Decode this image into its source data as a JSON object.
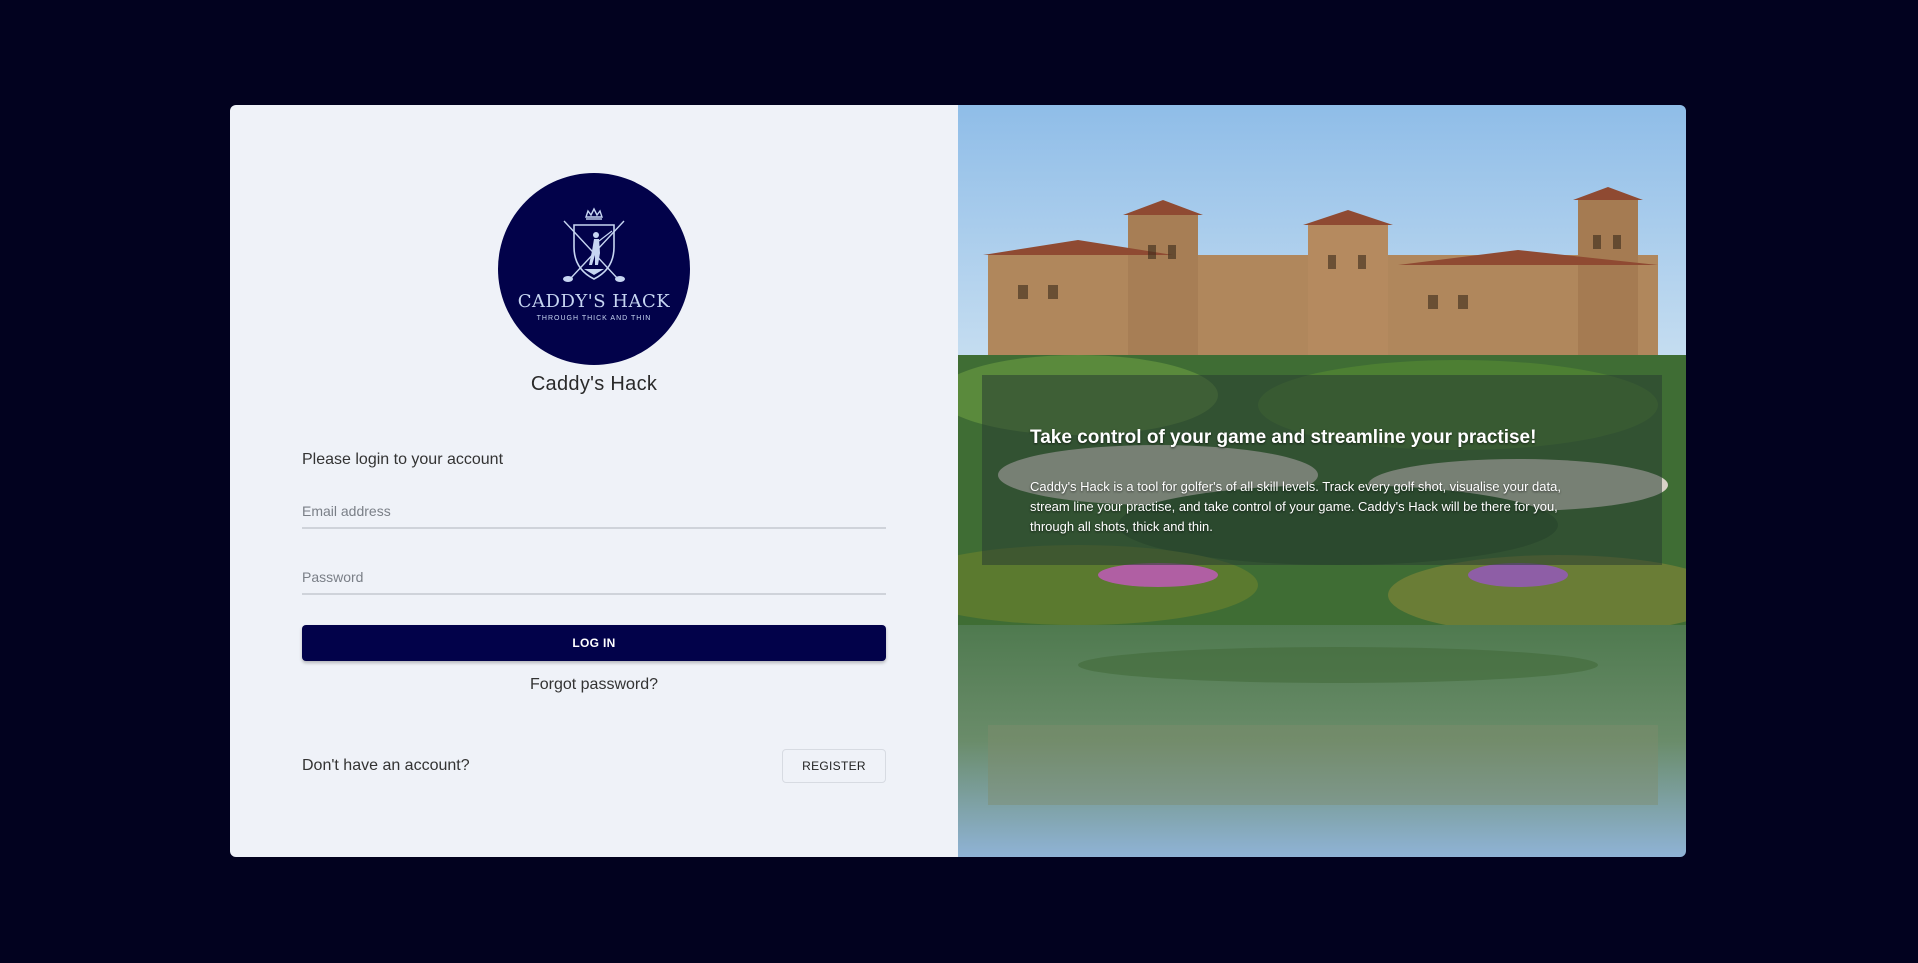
{
  "brand": {
    "name": "Caddy's Hack",
    "logo_text": "CADDY'S HACK",
    "logo_tagline": "THROUGH THICK AND THIN"
  },
  "login": {
    "prompt": "Please login to your account",
    "email_placeholder": "Email address",
    "password_placeholder": "Password",
    "login_button": "LOG IN",
    "forgot_password": "Forgot password?",
    "no_account": "Don't have an account?",
    "register_button": "REGISTER"
  },
  "promo": {
    "headline": "Take control of your game and streamline your practise!",
    "description": "Caddy's Hack is a tool for golfer's of all skill levels. Track every golf shot, visualise your data, stream line your practise, and take control of your game. Caddy's Hack will be there for you, through all shots, thick and thin."
  },
  "colors": {
    "page_background": "#02021f",
    "panel_background": "#eff2f8",
    "brand_navy": "#02024a"
  },
  "icons": {
    "logo": "golfer-crest-icon"
  }
}
